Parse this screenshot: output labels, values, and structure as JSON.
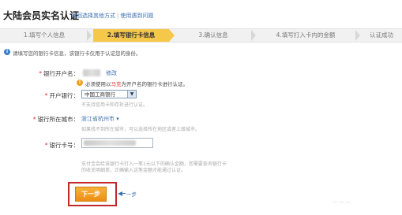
{
  "header": {
    "title": "大陆会员实名认证",
    "link_return": "返回选择其他方式",
    "separator": "|",
    "link_faq": "使用遇到问题"
  },
  "steps": [
    {
      "label": "1.填写个人信息",
      "active": false
    },
    {
      "label": "2.填写银行卡信息",
      "active": true
    },
    {
      "label": "3.确认信息",
      "active": false
    },
    {
      "label": "4.填写打入卡内的金额",
      "active": false
    },
    {
      "label": "认证成功",
      "active": false
    }
  ],
  "notice": {
    "icon": "info-icon",
    "text": "请填写您的银行卡信息，该银行卡仅用于认证您的身份。"
  },
  "form": {
    "account_name": {
      "label": "银行开户名：",
      "modify_link": "修改",
      "warning_icon": "warning-icon",
      "warning_prefix": "必须使用以",
      "warning_highlight": "马克",
      "warning_suffix": "为开户名的银行卡进行认证。"
    },
    "bank": {
      "label": "开户银行：",
      "selected": "中国工商银行",
      "hint": "不支持信用卡和存折进行认证。"
    },
    "city": {
      "label": "银行所在城市：",
      "selected": "浙江省杭州市",
      "hint": "如果找不到所在城市，可以选择所在地区或者上级城市。"
    },
    "card_number": {
      "label": "银行卡号：",
      "value": "",
      "hint_line1": "支付宝会给该银行卡打入一笔1元以下的确认金额，您需要查询银行卡",
      "hint_line2": "的收支明细单，正确输入这笔金额才能通过认证。"
    },
    "required_mark": "*"
  },
  "actions": {
    "next_label": "下一步"
  },
  "annotation": {
    "label": "一步"
  },
  "colors": {
    "active_step": "#f6c84a",
    "next_button": "#ec8e12",
    "highlight_border": "#c0282a",
    "link": "#3a6fb0"
  }
}
